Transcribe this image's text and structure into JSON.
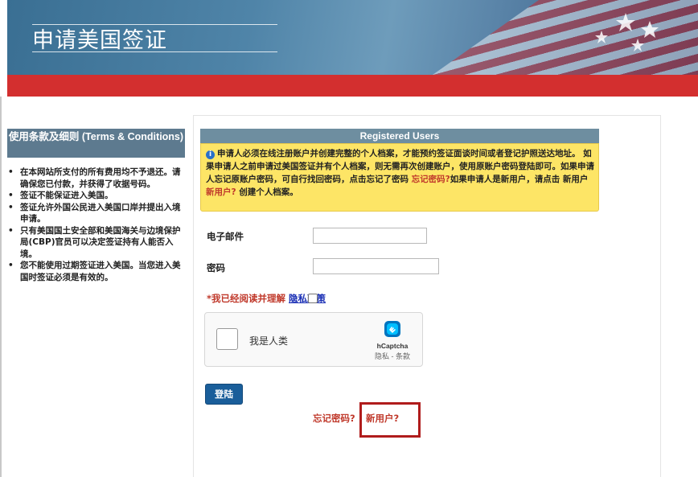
{
  "banner": {
    "title": "申请美国签证"
  },
  "sidebar": {
    "header": "使用条款及细则 (Terms & Conditions)",
    "items": [
      "在本网站所支付的所有费用均不予退还。请确保您已付款，并获得了收据号码。",
      "签证不能保证进入美国。",
      "签证允许外国公民进入美国口岸并提出入境申请。",
      "只有美国国土安全部和美国海关与边境保护局(CBP)官员可以决定签证持有人能否入境。",
      "您不能使用过期签证进入美国。当您进入美国时签证必须是有效的。"
    ]
  },
  "registered": {
    "header": "Registered Users",
    "notice_part1": "申请人必须在线注册账户并创建完整的个人档案，才能预约签证面谈时间或者登记护照送达地址。 如果申请人之前申请过美国签证并有个人档案，则无需再次创建账户，使用原账户密码登陆即可。如果申请人忘记原账户密码，可自行找回密码，点击忘记了密码",
    "notice_forgot_link": "忘记密码?",
    "notice_part2": "如果申请人是新用户，请点击 新用户",
    "notice_newuser_link": "新用户?",
    "notice_part3": "创建个人档案。"
  },
  "form": {
    "email_label": "电子邮件",
    "email_value": "",
    "password_label": "密码",
    "password_value": "",
    "agree_text": "*我已经阅读并理解",
    "privacy_link": "隐私政策"
  },
  "captcha": {
    "label": "我是人类",
    "brand": "hCaptcha",
    "links": "隐私 - 条款"
  },
  "actions": {
    "login_label": "登陆",
    "forgot_label": "忘记密码?",
    "newuser_label": "新用户?"
  },
  "colors": {
    "red_bar": "#d32f2f",
    "header_bg": "#5d7a8f",
    "notice_bg": "#fde566",
    "login_btn": "#1a5e9a",
    "link_red": "#c0392b",
    "highlight": "#b01c1c"
  },
  "icons": {
    "info": "info-circle-icon",
    "captcha_logo": "hcaptcha-logo-icon",
    "banner_stars": "star-icon"
  }
}
